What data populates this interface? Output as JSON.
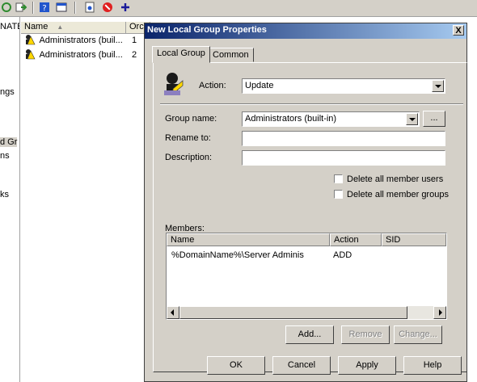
{
  "mmc": {
    "left_pane_fragments": [
      "NATE",
      "ngs",
      "d Gr",
      "ns",
      "ks"
    ],
    "list": {
      "columns": [
        "Name",
        "Orc"
      ],
      "rows": [
        {
          "name": "Administrators (buil...",
          "order": "1"
        },
        {
          "name": "Administrators (buil...",
          "order": "2"
        }
      ]
    }
  },
  "dialog": {
    "title": "New Local Group Properties",
    "close_label": "X",
    "tabs": [
      "Local Group",
      "Common"
    ],
    "action_label": "Action:",
    "action_value": "Update",
    "group_name_label": "Group name:",
    "group_name_value": "Administrators (built-in)",
    "browse_label": "...",
    "rename_label": "Rename to:",
    "description_label": "Description:",
    "delete_member_users": "Delete all member users",
    "delete_member_groups": "Delete all member groups",
    "members_label": "Members:",
    "members_columns": [
      "Name",
      "Action",
      "SID"
    ],
    "members_rows": [
      {
        "name": "%DomainName%\\Server Adminis",
        "action": "ADD",
        "sid": ""
      }
    ],
    "add_button": "Add...",
    "remove_button": "Remove",
    "change_button": "Change...",
    "ok_button": "OK",
    "cancel_button": "Cancel",
    "apply_button": "Apply",
    "help_button": "Help"
  }
}
